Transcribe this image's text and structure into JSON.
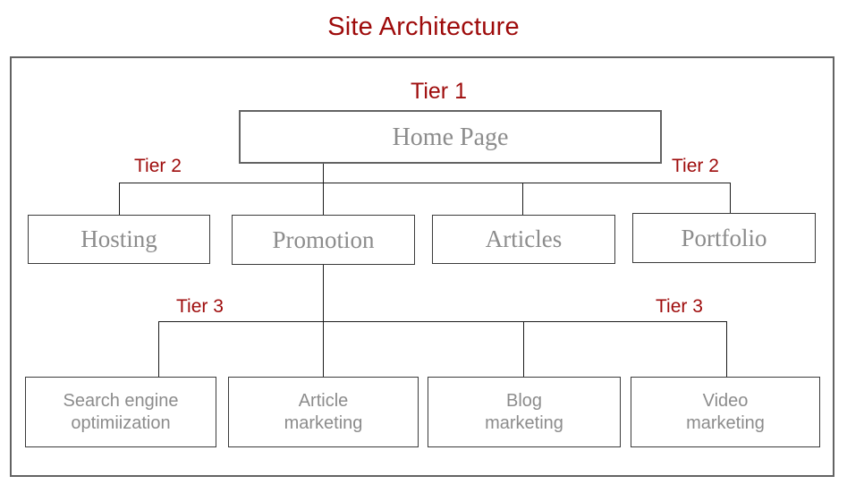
{
  "title": "Site Architecture",
  "colors": {
    "accent_red": "#9e0b0b",
    "frame_gray": "#636363",
    "node_text_gray": "#8c8c8c",
    "connector_black": "#1a1a1a",
    "background": "#ffffff"
  },
  "tier_labels": {
    "tier1": "Tier 1",
    "tier2_left": "Tier 2",
    "tier2_right": "Tier 2",
    "tier3_left": "Tier 3",
    "tier3_right": "Tier 3"
  },
  "nodes": {
    "home": {
      "label": "Home Page"
    },
    "tier2": [
      {
        "label": "Hosting"
      },
      {
        "label": "Promotion"
      },
      {
        "label": "Articles"
      },
      {
        "label": "Portfolio"
      }
    ],
    "tier3": [
      {
        "line1": "Search engine",
        "line2": "optimiization"
      },
      {
        "line1": "Article",
        "line2": "marketing"
      },
      {
        "line1": "Blog",
        "line2": "marketing"
      },
      {
        "line1": "Video",
        "line2": "marketing"
      }
    ]
  }
}
